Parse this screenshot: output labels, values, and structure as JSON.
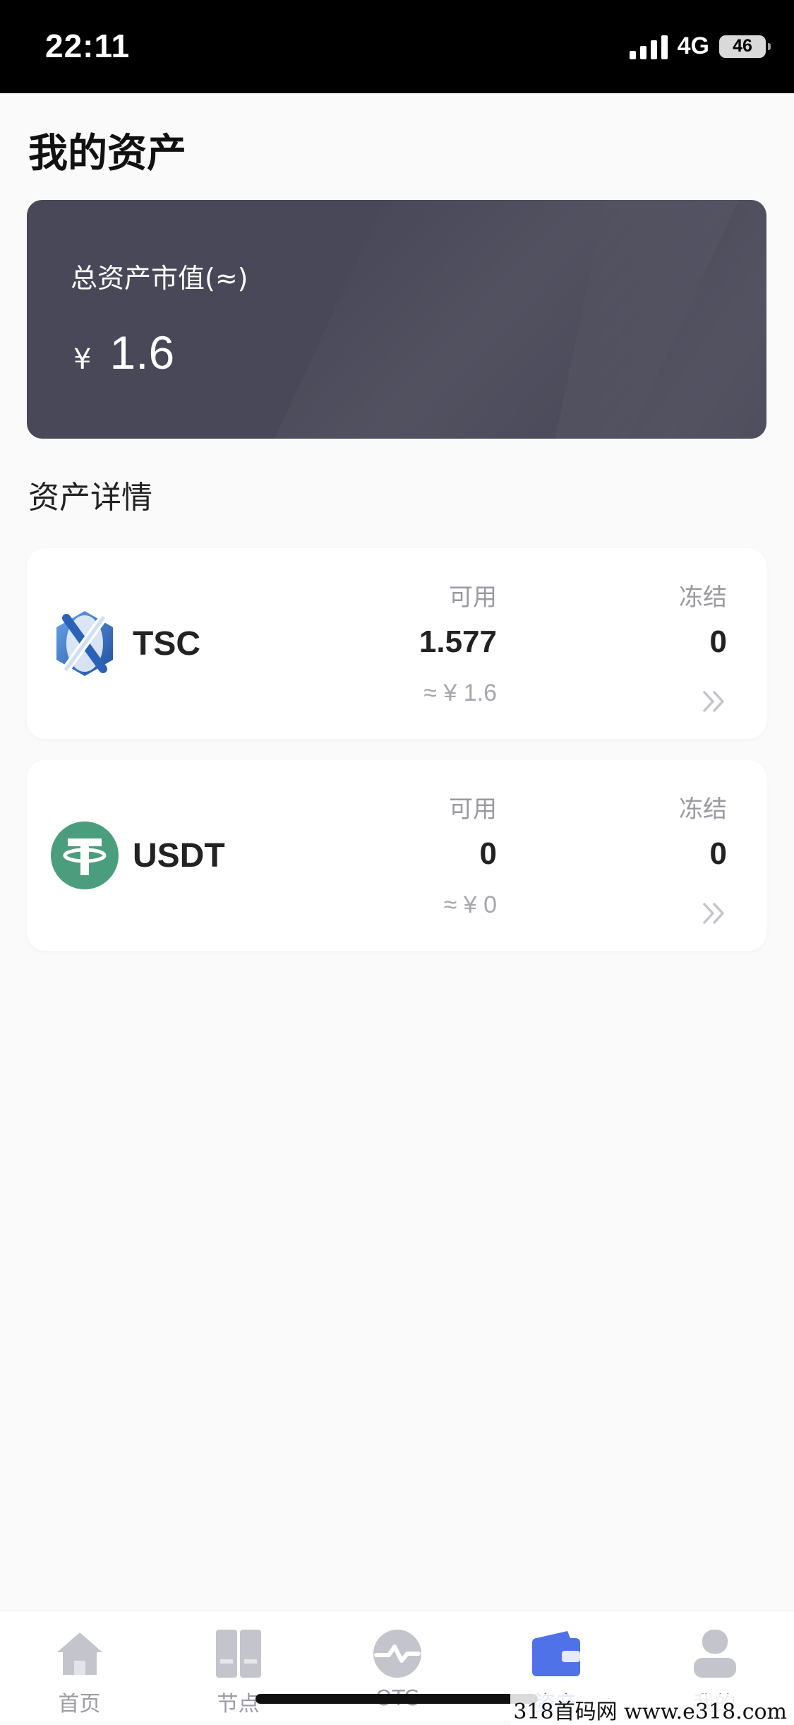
{
  "status_bar": {
    "time": "22:11",
    "network": "4G",
    "battery": "46"
  },
  "page": {
    "title": "我的资产"
  },
  "total_assets": {
    "label": "总资产市值(≈)",
    "currency": "¥",
    "value": "1.6"
  },
  "section": {
    "title": "资产详情"
  },
  "assets": [
    {
      "name": "TSC",
      "available_label": "可用",
      "available": "1.577",
      "approx": "≈ ¥ 1.6",
      "frozen_label": "冻结",
      "frozen": "0",
      "icon": "tsc-coin-icon"
    },
    {
      "name": "USDT",
      "available_label": "可用",
      "available": "0",
      "approx": "≈ ¥ 0",
      "frozen_label": "冻结",
      "frozen": "0",
      "icon": "usdt-coin-icon"
    }
  ],
  "tabs": [
    {
      "label": "首页",
      "icon": "home-icon"
    },
    {
      "label": "节点",
      "icon": "node-icon"
    },
    {
      "label": "OTC",
      "icon": "otc-icon"
    },
    {
      "label": "资产",
      "icon": "wallet-icon",
      "active": true
    },
    {
      "label": "我的",
      "icon": "profile-icon"
    }
  ],
  "colors": {
    "accent": "#4f72e8",
    "card_dark": "#484858",
    "usdt_green": "#4b9e7d",
    "tab_inactive": "#c4c4cc"
  },
  "watermark": "318首码网  www.e318.com"
}
